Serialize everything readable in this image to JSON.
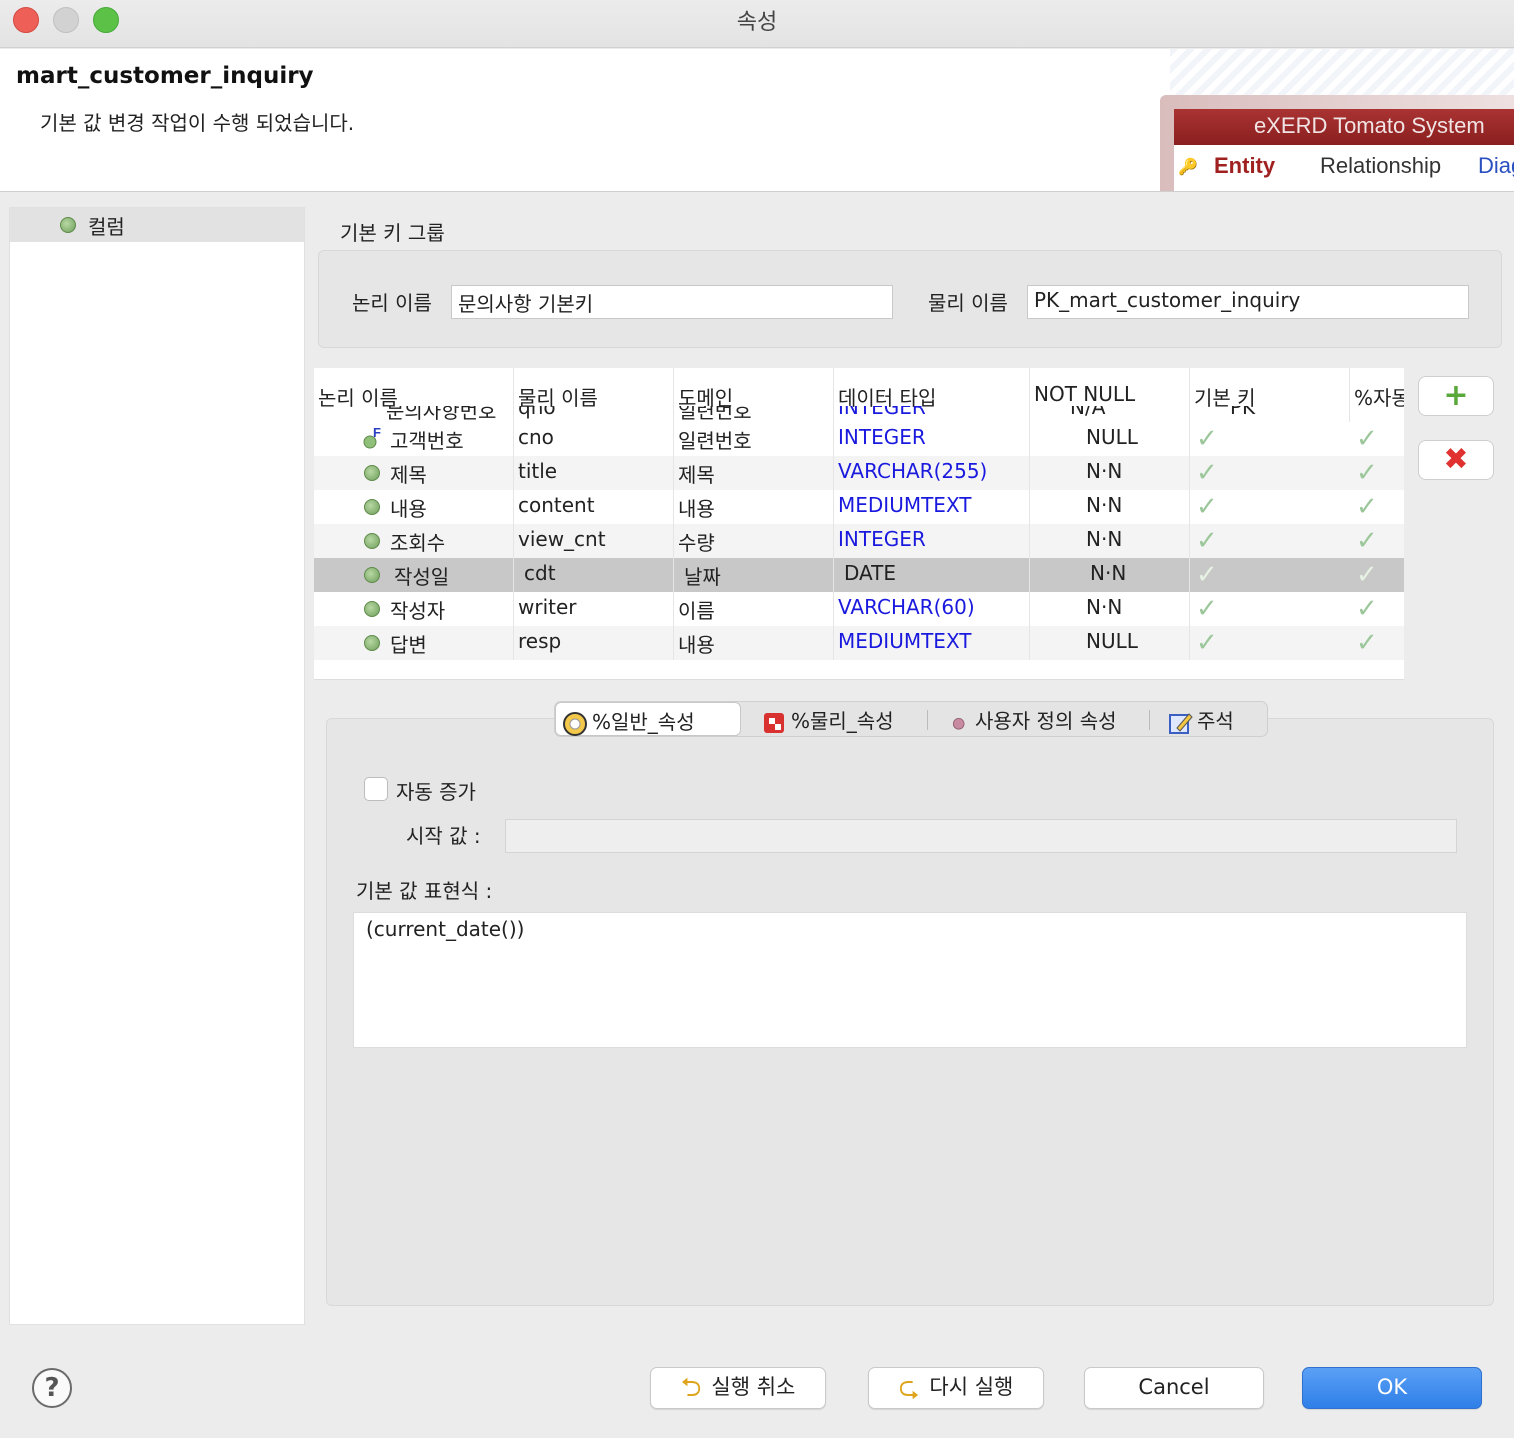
{
  "window": {
    "title": "속성"
  },
  "header": {
    "title": "mart_customer_inquiry",
    "message": "기본 값 변경 작업이 수행 되었습니다.",
    "banner": {
      "brand": "eXERD  Tomato System",
      "tabs": [
        "Entity",
        "Relationship",
        "Diag"
      ]
    }
  },
  "tree": {
    "items": [
      {
        "label": "컬럼",
        "icon": "column-dot-icon"
      }
    ]
  },
  "pk_group": {
    "title": "기본 키 그룹",
    "logical_label": "논리 이름",
    "logical_value": "문의사항 기본키",
    "physical_label": "물리 이름",
    "physical_value": "PK_mart_customer_inquiry"
  },
  "table": {
    "headers": [
      "논리 이름",
      "물리 이름",
      "도메인",
      "데이터 타입",
      "NOT NULL",
      "기본 키",
      "%자동"
    ],
    "partial_row": [
      "문의사항번호",
      "qno",
      "일련번호",
      "INTEGER",
      "N/A",
      "PK"
    ],
    "rows": [
      {
        "logical": "고객번호",
        "physical": "cno",
        "domain": "일련번호",
        "type": "INTEGER",
        "notnull": "NULL",
        "icon": "foreign-key-icon"
      },
      {
        "logical": "제목",
        "physical": "title",
        "domain": "제목",
        "type": "VARCHAR(255)",
        "notnull": "N·N",
        "icon": "column-dot-icon"
      },
      {
        "logical": "내용",
        "physical": "content",
        "domain": "내용",
        "type": "MEDIUMTEXT",
        "notnull": "N·N",
        "icon": "column-dot-icon"
      },
      {
        "logical": "조회수",
        "physical": "view_cnt",
        "domain": "수량",
        "type": "INTEGER",
        "notnull": "N·N",
        "icon": "column-dot-icon"
      },
      {
        "logical": "작성일",
        "physical": "cdt",
        "domain": "날짜",
        "type": "DATE",
        "notnull": "N·N",
        "icon": "column-dot-icon",
        "selected": true
      },
      {
        "logical": "작성자",
        "physical": "writer",
        "domain": "이름",
        "type": "VARCHAR(60)",
        "notnull": "N·N",
        "icon": "column-dot-icon"
      },
      {
        "logical": "답변",
        "physical": "resp",
        "domain": "내용",
        "type": "MEDIUMTEXT",
        "notnull": "NULL",
        "icon": "column-dot-icon"
      }
    ],
    "type_color": "#1a1adf"
  },
  "side_buttons": {
    "add_icon": "plus-icon",
    "delete_icon": "delete-x-icon"
  },
  "tabs": [
    {
      "label": "%일반_속성",
      "icon": "general-props-icon",
      "active": true
    },
    {
      "label": "%물리_속성",
      "icon": "physical-props-icon"
    },
    {
      "label": "사용자 정의 속성",
      "icon": "user-props-icon"
    },
    {
      "label": "주석",
      "icon": "comment-pencil-icon"
    }
  ],
  "general": {
    "auto_increment_label": "자동 증가",
    "auto_increment_checked": false,
    "start_label": "시작 값 :",
    "start_value": "",
    "default_expr_label": "기본 값 표현식 :",
    "default_expr_value": "(current_date())"
  },
  "footer": {
    "help": "?",
    "undo": "실행 취소",
    "redo": "다시 실행",
    "cancel": "Cancel",
    "ok": "OK"
  },
  "colors": {
    "accent": "#2f7fe8",
    "check": "#9cc79a",
    "error": "#e03030",
    "add": "#5aa83a"
  }
}
